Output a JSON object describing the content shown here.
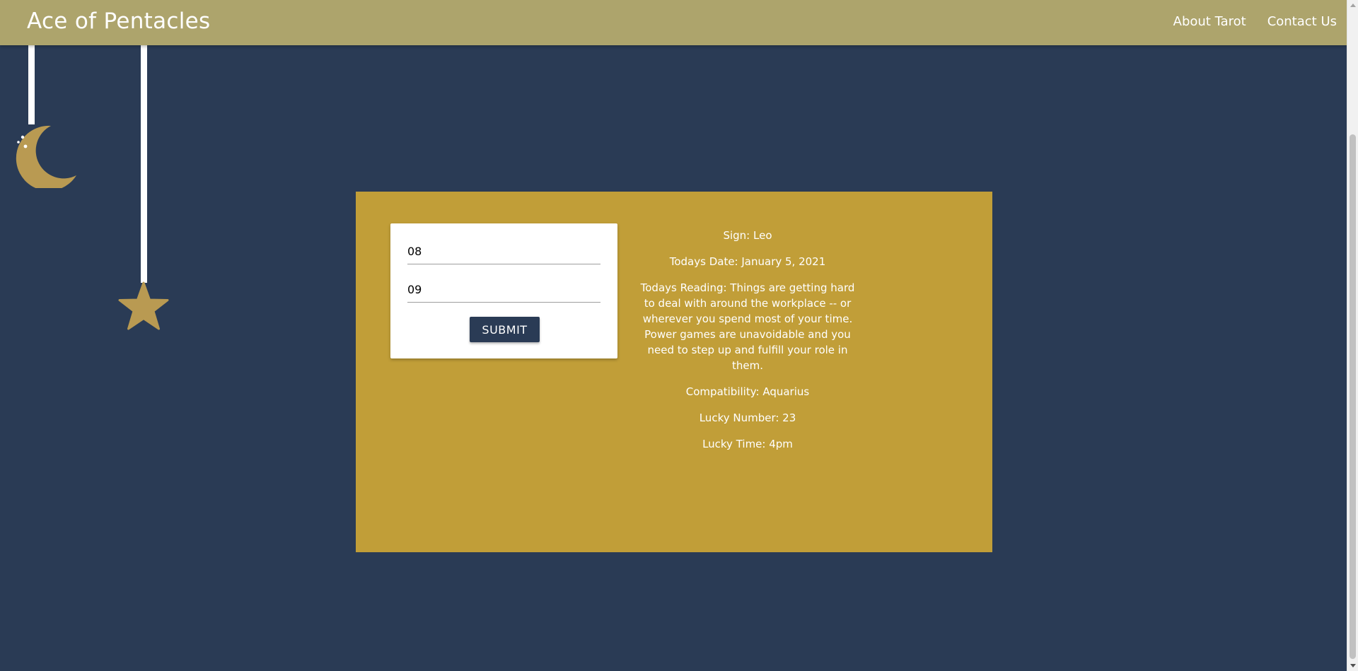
{
  "navbar": {
    "brand": "Ace of Pentacles",
    "links": [
      {
        "label": "About Tarot"
      },
      {
        "label": "Contact Us"
      }
    ]
  },
  "form": {
    "month_value": "08",
    "day_value": "09",
    "submit_label": "SUBMIT"
  },
  "reading": {
    "sign": "Sign: Leo",
    "date": "Todays Date: January 5, 2021",
    "text": "Todays Reading: Things are getting hard to deal with around the workplace -- or wherever you spend most of your time. Power games are unavoidable and you need to step up and fulfill your role in them.",
    "compatibility": "Compatibility: Aquarius",
    "lucky_number": "Lucky Number: 23",
    "lucky_time": "Lucky Time: 4pm"
  },
  "icons": {
    "moon": "crescent-moon-icon",
    "star": "star-icon"
  },
  "colors": {
    "background": "#2a3b55",
    "navbar": "#ada46c",
    "panel": "#c19e38",
    "ornament": "#b99a52",
    "button": "#2a3b55"
  }
}
